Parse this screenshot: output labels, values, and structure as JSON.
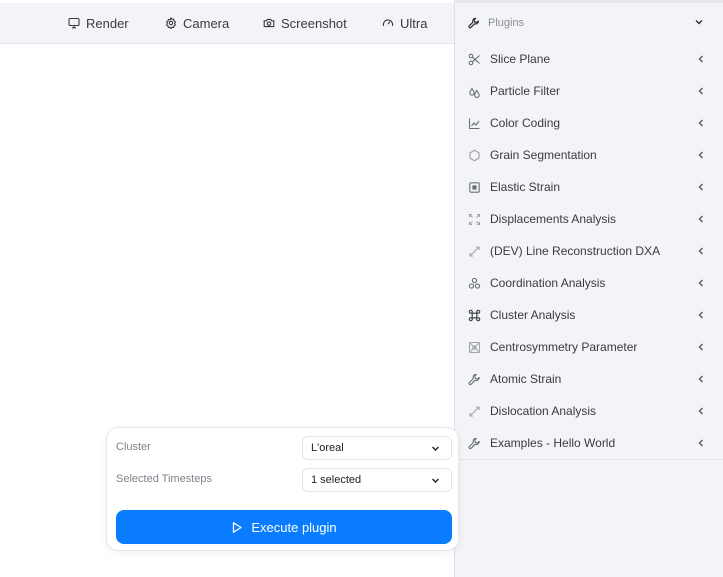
{
  "toolbar": {
    "items": [
      {
        "label": "Render",
        "icon": "monitor-icon"
      },
      {
        "label": "Camera",
        "icon": "gear-icon"
      },
      {
        "label": "Screenshot",
        "icon": "camera-icon"
      },
      {
        "label": "Ultra",
        "icon": "gauge-icon"
      }
    ]
  },
  "plugins": {
    "title": "Plugins",
    "icon": "wrench-icon",
    "items": [
      {
        "label": "Slice Plane",
        "icon": "scissors-icon"
      },
      {
        "label": "Particle Filter",
        "icon": "droplets-icon"
      },
      {
        "label": "Color Coding",
        "icon": "line-chart-icon"
      },
      {
        "label": "Grain Segmentation",
        "icon": "hexagon-icon"
      },
      {
        "label": "Elastic Strain",
        "icon": "square-dot-icon"
      },
      {
        "label": "Displacements Analysis",
        "icon": "expand-icon"
      },
      {
        "label": "(DEV) Line Reconstruction DXA",
        "icon": "diagonal-arrows-icon"
      },
      {
        "label": "Coordination Analysis",
        "icon": "atom-cluster-icon"
      },
      {
        "label": "Cluster Analysis",
        "icon": "bone-cluster-icon"
      },
      {
        "label": "Centrosymmetry Parameter",
        "icon": "cross-pattern-icon"
      },
      {
        "label": "Atomic Strain",
        "icon": "wrench-icon"
      },
      {
        "label": "Dislocation Analysis",
        "icon": "diagonal-arrows-icon"
      },
      {
        "label": "Examples - Hello World",
        "icon": "wrench-icon"
      }
    ]
  },
  "exec": {
    "cluster_label": "Cluster",
    "cluster_value": "L'oreal",
    "timesteps_label": "Selected Timesteps",
    "timesteps_value": "1 selected",
    "button_label": "Execute plugin"
  },
  "colors": {
    "accent": "#0a7cff",
    "panel_bg": "#f3f4f7",
    "canvas_bg": "#ffffff"
  }
}
